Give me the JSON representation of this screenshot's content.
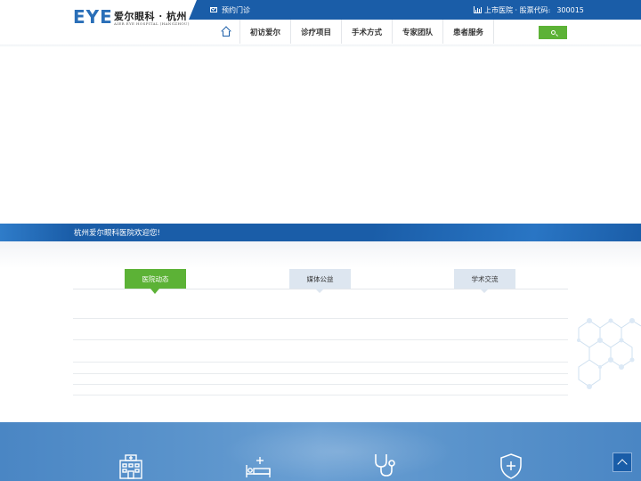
{
  "header": {
    "logo": {
      "mark": "EYE",
      "name_cn": "爱尔眼科 · 杭州",
      "name_en": "AIER EYE HOSPITAL (HANGZHOU)"
    },
    "topbar": {
      "appointment": "预约门诊",
      "stock_label": "上市医院 · 股票代码:",
      "stock_code": "300015"
    },
    "nav": [
      {
        "label": "初访爱尔"
      },
      {
        "label": "诊疗项目"
      },
      {
        "label": "手术方式"
      },
      {
        "label": "专家团队"
      },
      {
        "label": "患者服务"
      }
    ]
  },
  "welcome": {
    "text": "杭州爱尔眼科医院欢迎您!"
  },
  "news": {
    "tabs": [
      {
        "label": "医院动态",
        "active": true
      },
      {
        "label": "媒体公益",
        "active": false
      },
      {
        "label": "学术交流",
        "active": false
      }
    ]
  },
  "services": {
    "icons": [
      "hospital-icon",
      "bed-icon",
      "stethoscope-icon",
      "shield-medical-icon"
    ]
  },
  "colors": {
    "primary_blue": "#1a5da8",
    "accent_green": "#5cb236",
    "tab_inactive": "#dde6f0"
  }
}
